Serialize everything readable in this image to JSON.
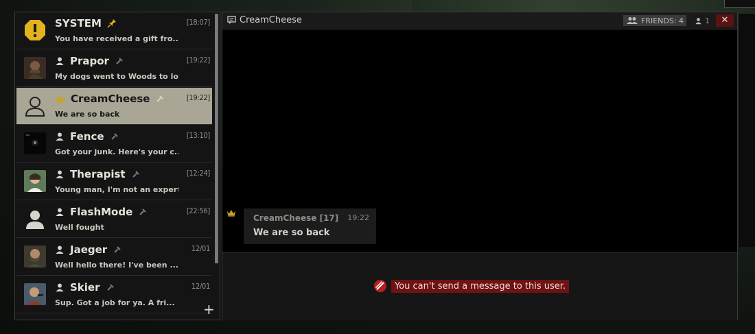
{
  "contacts": [
    {
      "name": "SYSTEM",
      "message": "You have received a gift fro...",
      "time": "[18:07]",
      "avatar": "warning-icon",
      "badge": "pin"
    },
    {
      "name": "Prapor",
      "message": "My dogs went to Woods to loo...",
      "time": "[19:22]",
      "avatar": "photo"
    },
    {
      "name": "CreamCheese",
      "message": "We are so back",
      "time": "[19:22]",
      "avatar": "user-silhouette-icon",
      "badge": "crown",
      "active": true
    },
    {
      "name": "Fence",
      "message": "Got your junk. Here's your c...",
      "time": "[13:10]",
      "avatar": "photo"
    },
    {
      "name": "Therapist",
      "message": "Young man, I'm not an expert...",
      "time": "[12:24]",
      "avatar": "photo"
    },
    {
      "name": "FlashMode",
      "message": "Well fought",
      "time": "[22:56]",
      "avatar": "user-silhouette-icon"
    },
    {
      "name": "Jaeger",
      "message": "Well hello there! I've been ...",
      "time": "12/01",
      "avatar": "photo"
    },
    {
      "name": "Skier",
      "message": "Sup. Got a job for ya. A fri...",
      "time": "12/01",
      "avatar": "photo"
    }
  ],
  "add_button": "+",
  "chat": {
    "title": "CreamCheese",
    "friends_label": "FRIENDS: 4",
    "member_count": "1",
    "close": "✕",
    "message": {
      "author": "CreamCheese [17]",
      "time": "19:22",
      "text": "We are so back"
    },
    "warning": "You can't send a message to this user."
  },
  "colors": {
    "accent_gold": "#c9a227",
    "active_row": "#a9a695",
    "warning_red": "#6e1212",
    "close_red": "#5a1212"
  }
}
